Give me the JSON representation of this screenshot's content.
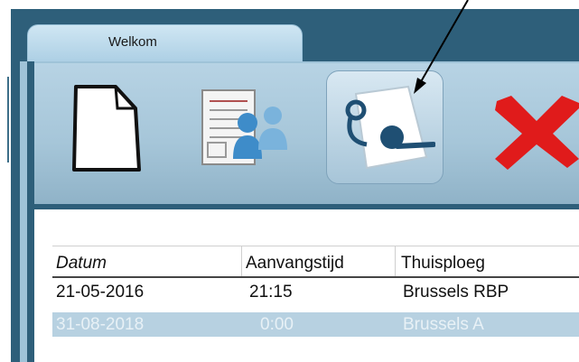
{
  "window": {
    "tabs": [
      {
        "label": "Welkom"
      }
    ]
  },
  "toolbar": {
    "buttons": [
      {
        "icon": "new-document-icon"
      },
      {
        "icon": "players-card-icon"
      },
      {
        "icon": "whistle-icon",
        "selected": true
      },
      {
        "icon": "delete-icon"
      }
    ]
  },
  "grid": {
    "columns": [
      "Datum",
      "Aanvangstijd",
      "Thuisploeg"
    ],
    "rows": [
      {
        "datum": "21-05-2016",
        "aanvangstijd": "21:15",
        "thuisploeg": "Brussels RBP"
      },
      {
        "datum": "31-08-2018",
        "aanvangstijd": "0:00",
        "thuisploeg": "Brussels A",
        "selected": true
      }
    ]
  },
  "colors": {
    "frame": "#2e5f7a",
    "toolbar": "#a6c6d9",
    "selected_row": "#b7d1e1",
    "delete_red": "#e01b1b"
  }
}
